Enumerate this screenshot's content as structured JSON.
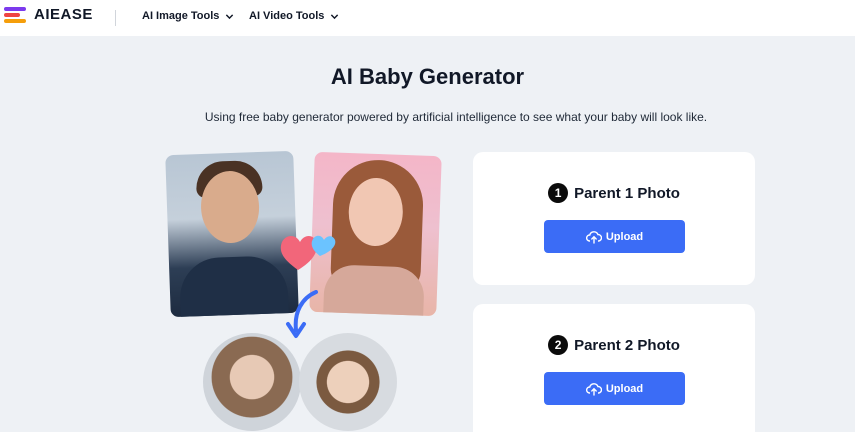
{
  "brand": {
    "name": "AIEASE"
  },
  "nav": {
    "items": [
      {
        "label": "AI Image Tools"
      },
      {
        "label": "AI Video Tools"
      }
    ]
  },
  "hero": {
    "title": "AI Baby Generator",
    "subtitle": "Using free baby generator powered by artificial intelligence to see what your baby will look like."
  },
  "cards": [
    {
      "step": "1",
      "label": "Parent 1 Photo",
      "button": "Upload"
    },
    {
      "step": "2",
      "label": "Parent 2 Photo",
      "button": "Upload"
    }
  ],
  "colors": {
    "accent": "#3b6cf6",
    "background": "#eef1f5",
    "logo": [
      "#7c3aed",
      "#ef4444",
      "#f59e0b"
    ]
  },
  "icons": {
    "logo": "aiease-logo-icon",
    "chevron": "chevron-down-icon",
    "upload": "cloud-upload-icon",
    "heart": "heart-icon",
    "arrow": "curved-arrow-icon"
  }
}
